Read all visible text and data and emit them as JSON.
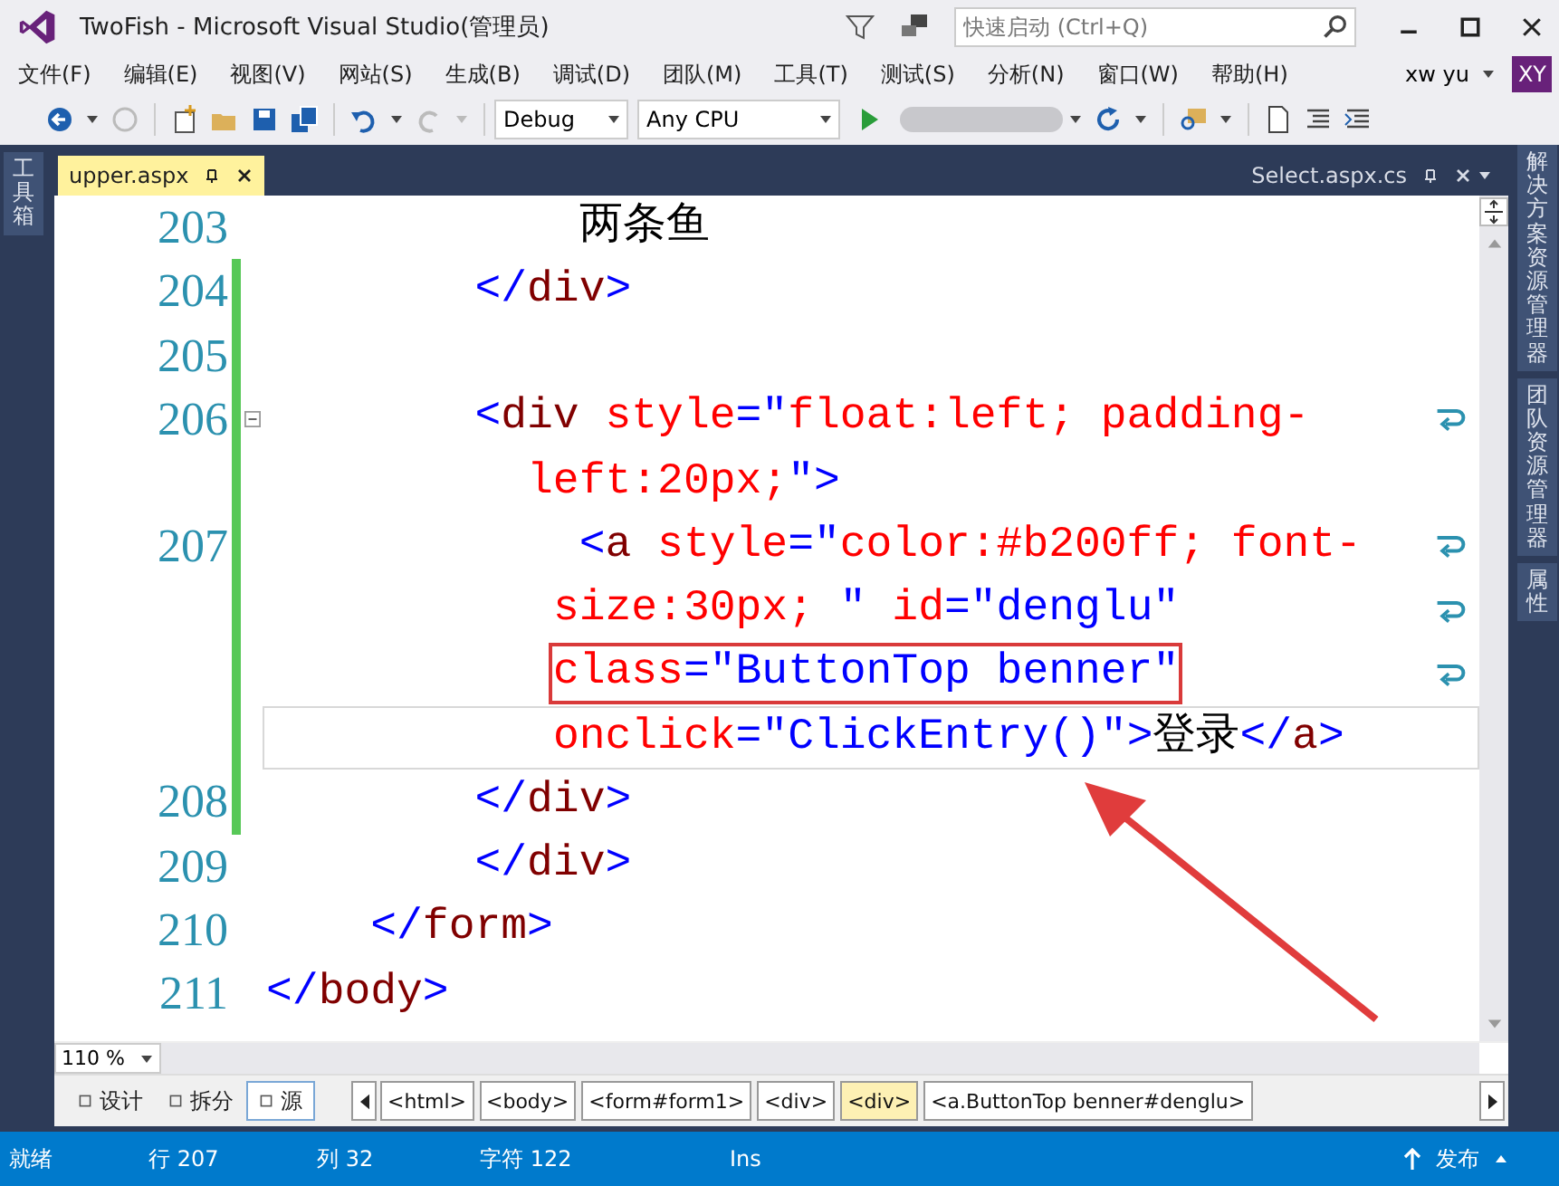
{
  "window": {
    "title": "TwoFish - Microsoft Visual Studio(管理员)"
  },
  "quick_launch": {
    "placeholder": "快速启动 (Ctrl+Q)"
  },
  "menu": [
    "文件(F)",
    "编辑(E)",
    "视图(V)",
    "网站(S)",
    "生成(B)",
    "调试(D)",
    "团队(M)",
    "工具(T)",
    "测试(S)",
    "分析(N)",
    "窗口(W)",
    "帮助(H)"
  ],
  "user": {
    "name": "xw yu",
    "initials": "XY"
  },
  "toolbar": {
    "configuration": "Debug",
    "platform": "Any CPU"
  },
  "left_sidebar": [
    "工具箱"
  ],
  "right_sidebar": [
    "解决方案资源管理器",
    "团队资源管理器",
    "属性"
  ],
  "tabs": [
    {
      "label": "upper.aspx",
      "selected": true
    },
    {
      "label": "Select.aspx.cs",
      "selected": false
    }
  ],
  "editor": {
    "zoom": "110 %",
    "rows": [
      {
        "number": "203",
        "changed": false,
        "fold": false,
        "wrap": false,
        "current": false,
        "boxed": false,
        "segments": [
          {
            "kind": "text",
            "text": "            两条鱼"
          }
        ]
      },
      {
        "number": "204",
        "changed": true,
        "fold": false,
        "wrap": false,
        "current": false,
        "boxed": false,
        "segments": [
          {
            "kind": "punct",
            "text": "        </"
          },
          {
            "kind": "tag",
            "text": "div"
          },
          {
            "kind": "punct",
            "text": ">"
          }
        ]
      },
      {
        "number": "205",
        "changed": true,
        "fold": false,
        "wrap": false,
        "current": false,
        "boxed": false
      },
      {
        "number": "206",
        "changed": true,
        "fold": true,
        "wrap": true,
        "current": false,
        "boxed": false,
        "segments": [
          {
            "kind": "punct",
            "text": "        <"
          },
          {
            "kind": "tag",
            "text": "div"
          },
          {
            "kind": "attr",
            "text": " style"
          },
          {
            "kind": "punct",
            "text": "=\""
          },
          {
            "kind": "attr",
            "text": "float:left; padding-"
          }
        ]
      },
      {
        "changed": true,
        "fold": false,
        "wrap": false,
        "current": false,
        "boxed": false,
        "segments": [
          {
            "kind": "attr",
            "text": "          left:20px;"
          },
          {
            "kind": "punct",
            "text": "\">"
          }
        ]
      },
      {
        "number": "207",
        "changed": true,
        "fold": false,
        "wrap": true,
        "current": false,
        "boxed": false,
        "segments": [
          {
            "kind": "punct",
            "text": "            <"
          },
          {
            "kind": "tag",
            "text": "a"
          },
          {
            "kind": "attr",
            "text": " style"
          },
          {
            "kind": "punct",
            "text": "=\""
          },
          {
            "kind": "attr",
            "text": "color:#b200ff; font-"
          }
        ]
      },
      {
        "changed": true,
        "fold": false,
        "wrap": true,
        "current": false,
        "boxed": false,
        "segments": [
          {
            "kind": "attr",
            "text": "           size:30px; "
          },
          {
            "kind": "punct",
            "text": "\""
          },
          {
            "kind": "attr",
            "text": " id"
          },
          {
            "kind": "punct",
            "text": "="
          },
          {
            "kind": "value",
            "text": "\"denglu\""
          }
        ]
      },
      {
        "changed": true,
        "fold": false,
        "wrap": true,
        "current": false,
        "boxed": true,
        "segments": [
          {
            "kind": "attr",
            "text": "           class"
          },
          {
            "kind": "punct",
            "text": "="
          },
          {
            "kind": "value",
            "text": "\"ButtonTop benner\""
          }
        ]
      },
      {
        "changed": true,
        "fold": false,
        "wrap": false,
        "current": true,
        "boxed": false,
        "segments": [
          {
            "kind": "attr",
            "text": "           onclick"
          },
          {
            "kind": "punct",
            "text": "="
          },
          {
            "kind": "value",
            "text": "\"ClickEntry()\""
          },
          {
            "kind": "punct",
            "text": ">"
          },
          {
            "kind": "text",
            "text": "登录"
          },
          {
            "kind": "punct",
            "text": "</"
          },
          {
            "kind": "tag",
            "text": "a"
          },
          {
            "kind": "punct",
            "text": ">"
          }
        ]
      },
      {
        "number": "208",
        "changed": true,
        "fold": false,
        "wrap": false,
        "current": false,
        "boxed": false,
        "segments": [
          {
            "kind": "punct",
            "text": "        </"
          },
          {
            "kind": "tag",
            "text": "div"
          },
          {
            "kind": "punct",
            "text": ">"
          }
        ]
      },
      {
        "number": "209",
        "changed": false,
        "fold": false,
        "wrap": false,
        "current": false,
        "boxed": false,
        "segments": [
          {
            "kind": "punct",
            "text": "        </"
          },
          {
            "kind": "tag",
            "text": "div"
          },
          {
            "kind": "punct",
            "text": ">"
          }
        ]
      },
      {
        "number": "210",
        "changed": false,
        "fold": false,
        "wrap": false,
        "current": false,
        "boxed": false,
        "segments": [
          {
            "kind": "punct",
            "text": "    </"
          },
          {
            "kind": "tag",
            "text": "form"
          },
          {
            "kind": "punct",
            "text": ">"
          }
        ]
      },
      {
        "number": "211",
        "changed": false,
        "fold": false,
        "wrap": false,
        "current": false,
        "boxed": false,
        "segments": [
          {
            "kind": "punct",
            "text": "</"
          },
          {
            "kind": "tag",
            "text": "body"
          },
          {
            "kind": "punct",
            "text": ">"
          }
        ]
      }
    ]
  },
  "view_tabs": [
    {
      "label": "设计",
      "selected": false
    },
    {
      "label": "拆分",
      "selected": false
    },
    {
      "label": "源",
      "selected": true
    }
  ],
  "breadcrumbs": [
    {
      "label": "<html>",
      "selected": false
    },
    {
      "label": "<body>",
      "selected": false
    },
    {
      "label": "<form#form1>",
      "selected": false
    },
    {
      "label": "<div>",
      "selected": false
    },
    {
      "label": "<div>",
      "selected": true
    },
    {
      "label": "<a.ButtonTop benner#denglu>",
      "selected": false
    }
  ],
  "status_bar": {
    "state": "就绪",
    "line": "行 207",
    "column": "列 32",
    "char": "字符 122",
    "mode": "Ins",
    "publish": "发布"
  }
}
